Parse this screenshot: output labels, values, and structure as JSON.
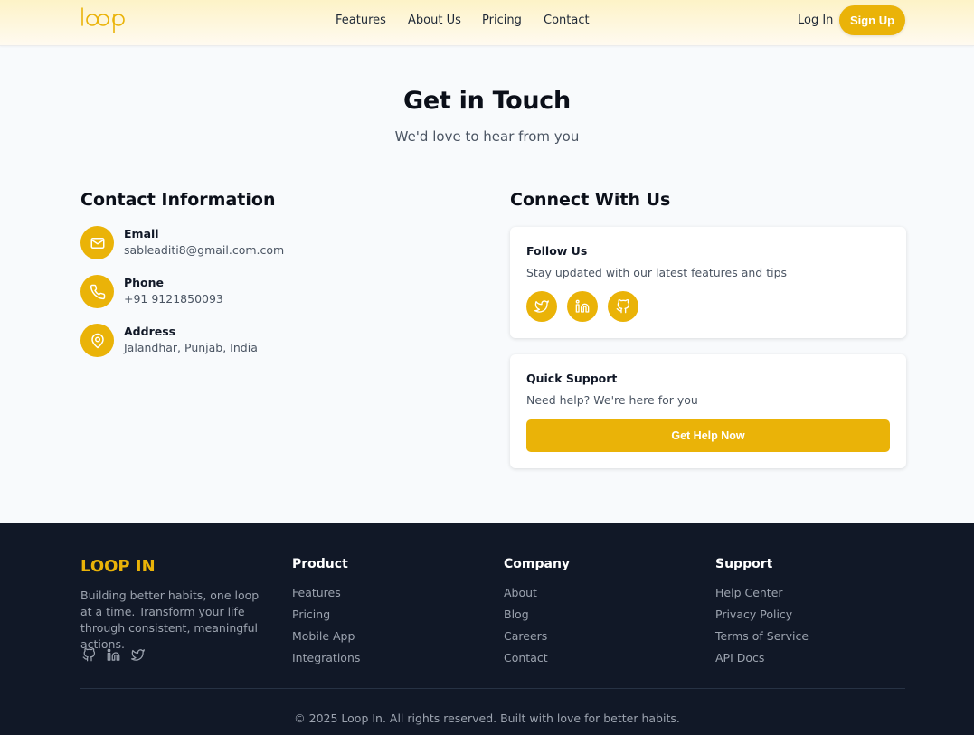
{
  "header": {
    "logo_text": "loop",
    "nav": [
      "Features",
      "About Us",
      "Pricing",
      "Contact"
    ],
    "login_label": "Log In",
    "signup_label": "Sign Up"
  },
  "hero": {
    "title": "Get in Touch",
    "subtitle": "We'd love to hear from you"
  },
  "contact_info": {
    "title": "Contact Information",
    "items": [
      {
        "label": "Email",
        "value": "sableaditi8@gmail.com.com",
        "icon": "mail-icon"
      },
      {
        "label": "Phone",
        "value": "+91 9121850093",
        "icon": "phone-icon"
      },
      {
        "label": "Address",
        "value": "Jalandhar, Punjab, India",
        "icon": "map-pin-icon"
      }
    ]
  },
  "connect": {
    "title": "Connect With Us",
    "follow": {
      "title": "Follow Us",
      "text": "Stay updated with our latest features and tips",
      "icons": [
        "twitter-icon",
        "linkedin-icon",
        "github-icon"
      ]
    },
    "support": {
      "title": "Quick Support",
      "text": "Need help? We're here for you",
      "button_label": "Get Help Now"
    }
  },
  "footer": {
    "brand": "LOOP IN",
    "tagline": "Building better habits, one loop at a time. Transform your life through consistent, meaningful actions.",
    "social_icons": [
      "github-icon",
      "linkedin-icon",
      "twitter-icon"
    ],
    "columns": [
      {
        "title": "Product",
        "links": [
          "Features",
          "Pricing",
          "Mobile App",
          "Integrations"
        ]
      },
      {
        "title": "Company",
        "links": [
          "About",
          "Blog",
          "Careers",
          "Contact"
        ]
      },
      {
        "title": "Support",
        "links": [
          "Help Center",
          "Privacy Policy",
          "Terms of Service",
          "API Docs"
        ]
      }
    ],
    "copyright": "© 2025 Loop In. All rights reserved. Built with love for better habits."
  },
  "colors": {
    "accent": "#eab308",
    "footer_bg": "#111827",
    "page_bg": "#f8fafc"
  }
}
